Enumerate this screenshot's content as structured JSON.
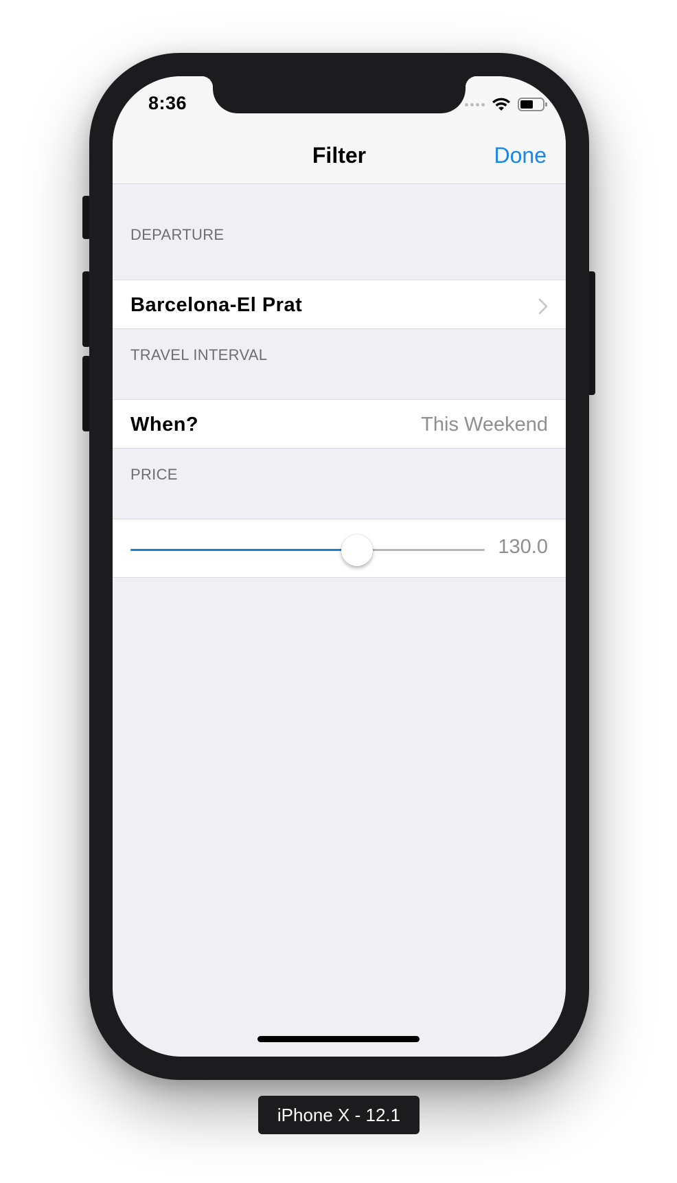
{
  "status_bar": {
    "time": "8:36"
  },
  "nav": {
    "title": "Filter",
    "done_label": "Done"
  },
  "sections": {
    "departure": {
      "header": "DEPARTURE",
      "value": "Barcelona-El Prat"
    },
    "travel_interval": {
      "header": "TRAVEL INTERVAL",
      "title": "When?",
      "value": "This Weekend"
    },
    "price": {
      "header": "PRICE",
      "value_label": "130.0",
      "slider_fraction": 0.64
    }
  },
  "device_label": "iPhone X - 12.1",
  "colors": {
    "accent": "#1a86e6",
    "background": "#efeff4",
    "secondary_text": "#8e8e93"
  }
}
